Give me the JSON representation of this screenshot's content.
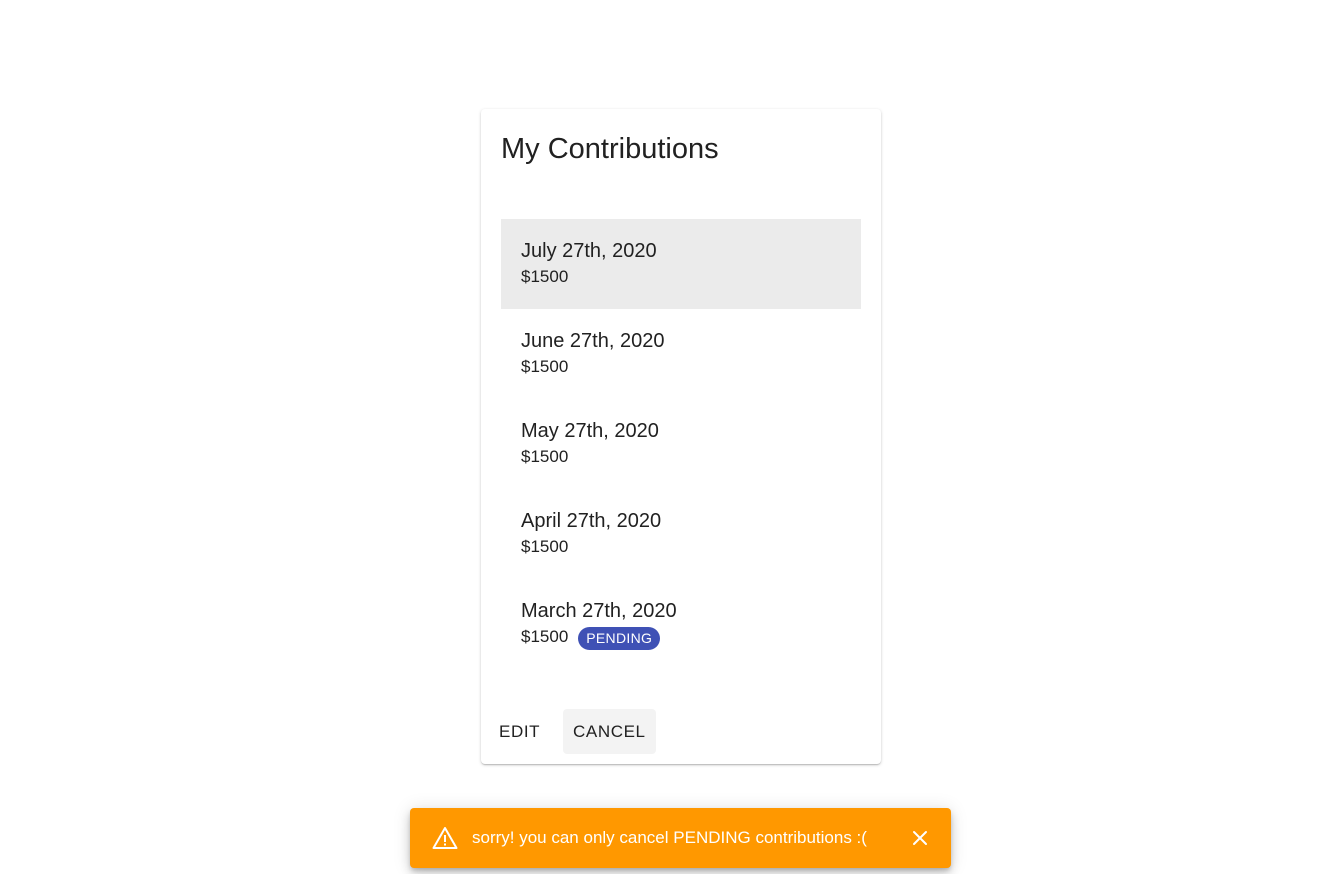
{
  "card": {
    "title": "My Contributions",
    "contributions": [
      {
        "date": "July 27th, 2020",
        "amount": "$1500",
        "status": ""
      },
      {
        "date": "June 27th, 2020",
        "amount": "$1500",
        "status": ""
      },
      {
        "date": "May 27th, 2020",
        "amount": "$1500",
        "status": ""
      },
      {
        "date": "April 27th, 2020",
        "amount": "$1500",
        "status": ""
      },
      {
        "date": "March 27th, 2020",
        "amount": "$1500",
        "status": "PENDING"
      }
    ],
    "actions": {
      "edit_label": "EDIT",
      "cancel_label": "CANCEL"
    }
  },
  "snackbar": {
    "message": "sorry! you can only cancel PENDING contributions :(",
    "icon": "warning-icon",
    "close_icon": "close-icon",
    "color": "#ff9800"
  },
  "colors": {
    "badge": "#3f51b5",
    "selected_row": "#ebebeb"
  }
}
